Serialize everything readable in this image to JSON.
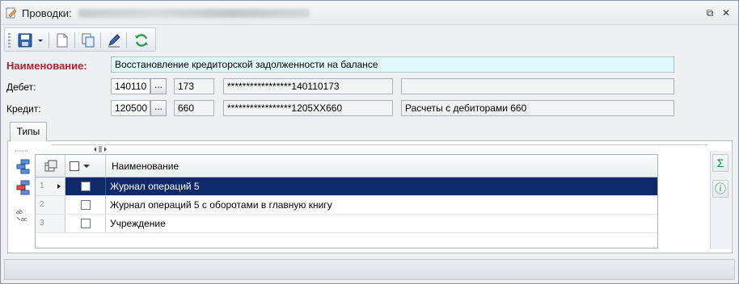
{
  "window": {
    "title": "Проводки:",
    "restore_glyph": "⧉",
    "close_glyph": "✕"
  },
  "toolbar": {
    "buttons": [
      "save-icon",
      "dropdown-arrow-icon",
      "new-document-icon",
      "copy-icon",
      "edit-pen-icon",
      "refresh-icon"
    ]
  },
  "form": {
    "name_label": "Наименование:",
    "name_value": "Восстановление кредиторской задолженности на балансе",
    "debit_label": "Дебет:",
    "debit": {
      "account": "140110",
      "sub": "173",
      "full": "*****************140110173",
      "description": ""
    },
    "credit_label": "Кредит:",
    "credit": {
      "account": "120500",
      "sub": "660",
      "full": "*****************1205XX660",
      "description": "Расчеты с дебиторами 660"
    },
    "dots_label": "..."
  },
  "tabs": [
    {
      "label": "Типы",
      "active": true
    }
  ],
  "grid": {
    "column_header": "Наименование",
    "rows": [
      {
        "num": "1",
        "checked": false,
        "name": "Журнал операций 5",
        "selected": true
      },
      {
        "num": "2",
        "checked": false,
        "name": "Журнал операций 5 с оборотами в главную книгу",
        "selected": false
      },
      {
        "num": "3",
        "checked": false,
        "name": "Учреждение",
        "selected": false
      }
    ]
  },
  "right_tools": {
    "sum_glyph": "Σ",
    "info_glyph": "ⓘ"
  },
  "colors": {
    "selection": "#0f2a6b",
    "name_field_bg": "#e2f9fc",
    "label_accent": "#a0282d"
  }
}
